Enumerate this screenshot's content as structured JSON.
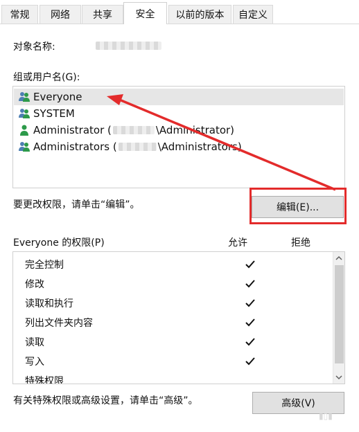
{
  "tabs": [
    {
      "label": "常规"
    },
    {
      "label": "网络"
    },
    {
      "label": "共享"
    },
    {
      "label": "安全"
    },
    {
      "label": "以前的版本"
    },
    {
      "label": "自定义"
    }
  ],
  "object_name": {
    "label": "对象名称:"
  },
  "groups": {
    "label": "组或用户名(G):",
    "items": [
      {
        "name": "Everyone",
        "icon": "group-icon"
      },
      {
        "name": "SYSTEM",
        "icon": "group-icon"
      },
      {
        "name_prefix": "Administrator (",
        "name_suffix": "\\Administrator)",
        "icon": "user-icon"
      },
      {
        "name_prefix": "Administrators (",
        "name_suffix": "\\Administrators)",
        "icon": "group-icon"
      }
    ]
  },
  "edit_hint": "要更改权限，请单击“编辑”。",
  "edit_button": "编辑(E)...",
  "permissions": {
    "header_label": "Everyone 的权限(P)",
    "allow_label": "允许",
    "deny_label": "拒绝",
    "rows": [
      {
        "label": "完全控制",
        "allow": true
      },
      {
        "label": "修改",
        "allow": true
      },
      {
        "label": "读取和执行",
        "allow": true
      },
      {
        "label": "列出文件夹内容",
        "allow": true
      },
      {
        "label": "读取",
        "allow": true
      },
      {
        "label": "写入",
        "allow": true
      },
      {
        "label": "特殊权限",
        "allow": false
      }
    ]
  },
  "advanced_hint": "有关特殊权限或高级设置，请单击“高级”。",
  "advanced_button": "高级(V)",
  "colors": {
    "annotation": "#e32b2b",
    "selection": "#e6e6e6"
  }
}
